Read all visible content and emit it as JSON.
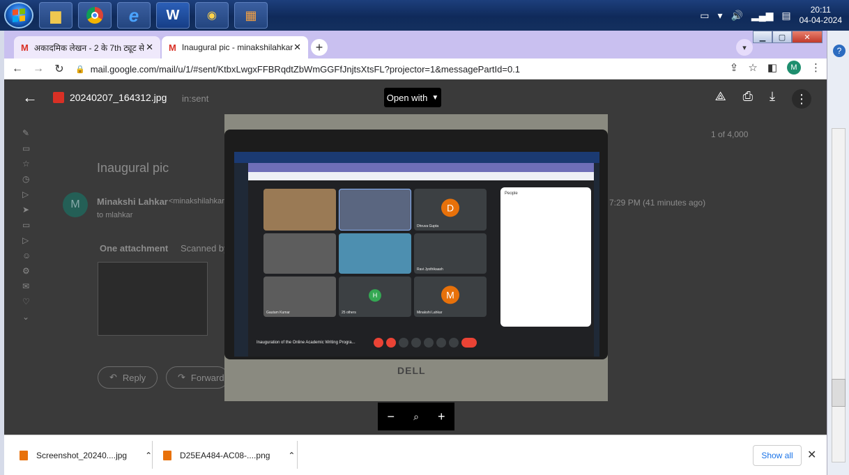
{
  "taskbar": {
    "apps": [
      "file-explorer",
      "chrome",
      "internet-explorer",
      "word",
      "chrome-colorful",
      "app-grid"
    ],
    "clock_time": "20:11",
    "clock_date": "04-04-2024"
  },
  "browser": {
    "tabs": [
      {
        "label": "अकादमिक लेखन - 2 के 7th ट्यूट से",
        "active": false
      },
      {
        "label": "Inaugural pic - minakshilahkar@",
        "active": true
      }
    ],
    "url": "mail.google.com/mail/u/1/#sent/KtbxLwgxFFBRqdtZbWmGGFfJnjtsXtsFL?projector=1&messagePartId=0.1",
    "avatar_letter": "M"
  },
  "viewer": {
    "file_name": "20240207_164312.jpg",
    "open_with": "Open with"
  },
  "gmail": {
    "search": "in:sent",
    "subject": "Inaugural pic",
    "sender": "Minakshi Lahkar",
    "sender_email": "<minakshilahkar",
    "to": "to mlahkar",
    "sent_time": "7:29 PM (41 minutes ago)",
    "count": "1 of 4,000",
    "attachment_label": "One attachment",
    "scanned": "Scanned by",
    "reply": "Reply",
    "forward": "Forward"
  },
  "photo_meet": {
    "participants": [
      "D",
      "H",
      "M"
    ],
    "names": [
      "Dhruva Gupta",
      "25 others",
      "Minakshi Lahkar",
      "Ravi Jyothikaash",
      "Gautam Kumar"
    ],
    "meeting_title": "Inauguration of the Online Academic Writing Progra...",
    "people_header": "People",
    "brand": "DELL"
  },
  "downloads": {
    "items": [
      "Screenshot_20240....jpg",
      "D25EA484-AC08-....png"
    ],
    "show_all": "Show all"
  }
}
